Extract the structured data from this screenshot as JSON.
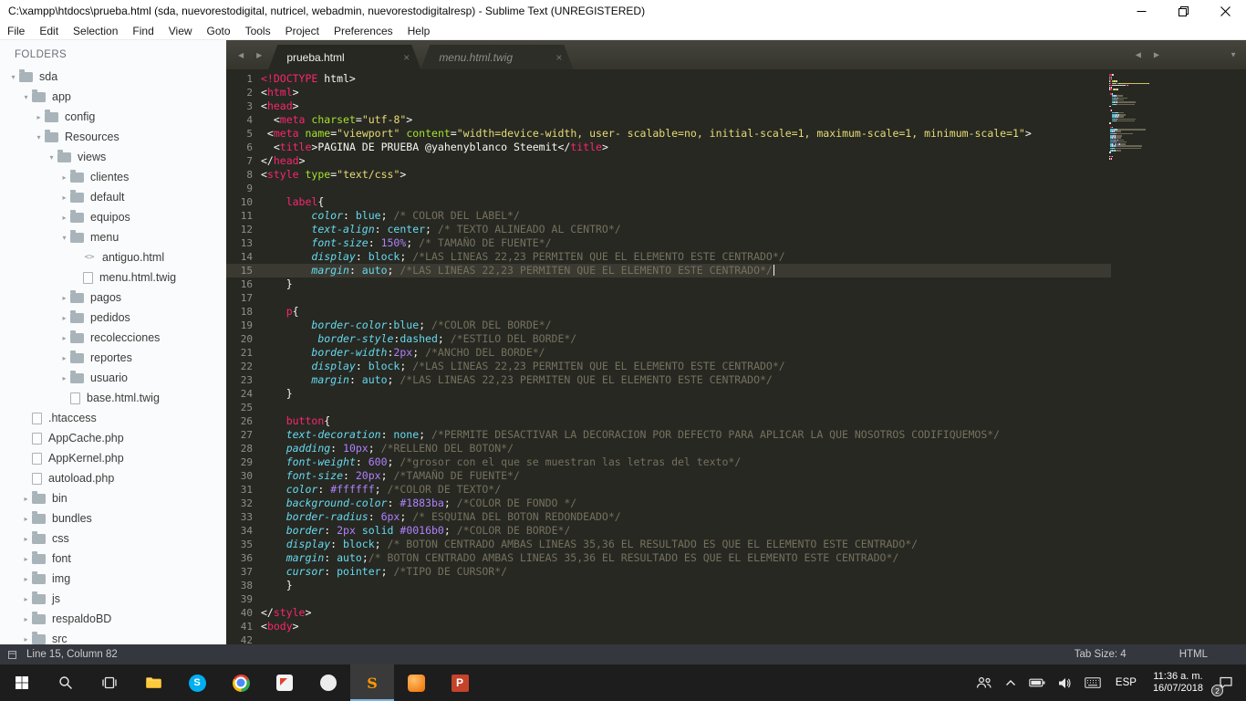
{
  "window": {
    "title": "C:\\xampp\\htdocs\\prueba.html (sda, nuevorestodigital, nutricel, webadmin, nuevorestodigitalresp) - Sublime Text (UNREGISTERED)"
  },
  "menubar": {
    "items": [
      "File",
      "Edit",
      "Selection",
      "Find",
      "View",
      "Goto",
      "Tools",
      "Project",
      "Preferences",
      "Help"
    ]
  },
  "sidebar": {
    "header": "FOLDERS",
    "items": [
      {
        "level": 0,
        "kind": "folder-open",
        "label": "sda"
      },
      {
        "level": 1,
        "kind": "folder-open",
        "label": "app"
      },
      {
        "level": 2,
        "kind": "folder-closed",
        "label": "config"
      },
      {
        "level": 2,
        "kind": "folder-open",
        "label": "Resources"
      },
      {
        "level": 3,
        "kind": "folder-open",
        "label": "views"
      },
      {
        "level": 4,
        "kind": "folder-closed",
        "label": "clientes"
      },
      {
        "level": 4,
        "kind": "folder-closed",
        "label": "default"
      },
      {
        "level": 4,
        "kind": "folder-closed",
        "label": "equipos"
      },
      {
        "level": 4,
        "kind": "folder-open",
        "label": "menu"
      },
      {
        "level": 5,
        "kind": "file-code",
        "label": "antiguo.html"
      },
      {
        "level": 5,
        "kind": "file",
        "label": "menu.html.twig"
      },
      {
        "level": 4,
        "kind": "folder-closed",
        "label": "pagos"
      },
      {
        "level": 4,
        "kind": "folder-closed",
        "label": "pedidos"
      },
      {
        "level": 4,
        "kind": "folder-closed",
        "label": "recolecciones"
      },
      {
        "level": 4,
        "kind": "folder-closed",
        "label": "reportes"
      },
      {
        "level": 4,
        "kind": "folder-closed",
        "label": "usuario"
      },
      {
        "level": 4,
        "kind": "file",
        "label": "base.html.twig"
      },
      {
        "level": 1,
        "kind": "file",
        "label": ".htaccess"
      },
      {
        "level": 1,
        "kind": "file",
        "label": "AppCache.php"
      },
      {
        "level": 1,
        "kind": "file",
        "label": "AppKernel.php"
      },
      {
        "level": 1,
        "kind": "file",
        "label": "autoload.php"
      },
      {
        "level": 1,
        "kind": "folder-closed",
        "label": "bin"
      },
      {
        "level": 1,
        "kind": "folder-closed",
        "label": "bundles"
      },
      {
        "level": 1,
        "kind": "folder-closed",
        "label": "css"
      },
      {
        "level": 1,
        "kind": "folder-closed",
        "label": "font"
      },
      {
        "level": 1,
        "kind": "folder-closed",
        "label": "img"
      },
      {
        "level": 1,
        "kind": "folder-closed",
        "label": "js"
      },
      {
        "level": 1,
        "kind": "folder-closed",
        "label": "respaldoBD"
      },
      {
        "level": 1,
        "kind": "folder-closed",
        "label": "src"
      }
    ]
  },
  "tabbar": {
    "tabs": [
      {
        "label": "prueba.html",
        "active": true
      },
      {
        "label": "menu.html.twig",
        "active": false
      }
    ]
  },
  "editor": {
    "current_line": 15,
    "lines": [
      [
        [
          "p",
          "<!DOCTYPE"
        ],
        [
          "w",
          " html>"
        ]
      ],
      [
        [
          "w",
          "<"
        ],
        [
          "p",
          "html"
        ],
        [
          "w",
          ">"
        ]
      ],
      [
        [
          "w",
          "<"
        ],
        [
          "p",
          "head"
        ],
        [
          "w",
          ">"
        ]
      ],
      [
        [
          "w",
          "  <"
        ],
        [
          "p",
          "meta"
        ],
        [
          "w",
          " "
        ],
        [
          "g",
          "charset"
        ],
        [
          "w",
          "="
        ],
        [
          "y",
          "\"utf-8\""
        ],
        [
          "w",
          ">"
        ]
      ],
      [
        [
          "w",
          " <"
        ],
        [
          "p",
          "meta"
        ],
        [
          "w",
          " "
        ],
        [
          "g",
          "name"
        ],
        [
          "w",
          "="
        ],
        [
          "y",
          "\"viewport\""
        ],
        [
          "w",
          " "
        ],
        [
          "g",
          "content"
        ],
        [
          "w",
          "="
        ],
        [
          "y",
          "\"width=device-width, user- scalable=no, initial-scale=1, maximum-scale=1, minimum-scale=1\""
        ],
        [
          "w",
          ">"
        ]
      ],
      [
        [
          "w",
          "  <"
        ],
        [
          "p",
          "title"
        ],
        [
          "w",
          ">"
        ],
        [
          "t",
          "PAGINA DE PRUEBA @yahenyblanco Steemit"
        ],
        [
          "w",
          "</"
        ],
        [
          "p",
          "title"
        ],
        [
          "w",
          ">"
        ]
      ],
      [
        [
          "w",
          "</"
        ],
        [
          "p",
          "head"
        ],
        [
          "w",
          ">"
        ]
      ],
      [
        [
          "w",
          "<"
        ],
        [
          "p",
          "style"
        ],
        [
          "w",
          " "
        ],
        [
          "g",
          "type"
        ],
        [
          "w",
          "="
        ],
        [
          "y",
          "\"text/css\""
        ],
        [
          "w",
          ">"
        ]
      ],
      [],
      [
        [
          "w",
          "    "
        ],
        [
          "p",
          "label"
        ],
        [
          "w",
          "{"
        ]
      ],
      [
        [
          "w",
          "        "
        ],
        [
          "ci",
          "color"
        ],
        [
          "w",
          ": "
        ],
        [
          "c",
          "blue"
        ],
        [
          "w",
          "; "
        ],
        [
          "cm",
          "/* COLOR DEL LABEL*/"
        ]
      ],
      [
        [
          "w",
          "        "
        ],
        [
          "ci",
          "text-align"
        ],
        [
          "w",
          ": "
        ],
        [
          "c",
          "center"
        ],
        [
          "w",
          "; "
        ],
        [
          "cm",
          "/* TEXTO ALINEADO AL CENTRO*/"
        ]
      ],
      [
        [
          "w",
          "        "
        ],
        [
          "ci",
          "font-size"
        ],
        [
          "w",
          ": "
        ],
        [
          "pu",
          "150%"
        ],
        [
          "w",
          "; "
        ],
        [
          "cm",
          "/* TAMAÑO DE FUENTE*/"
        ]
      ],
      [
        [
          "w",
          "        "
        ],
        [
          "ci",
          "display"
        ],
        [
          "w",
          ": "
        ],
        [
          "c",
          "block"
        ],
        [
          "w",
          "; "
        ],
        [
          "cm",
          "/*LAS LINEAS 22,23 PERMITEN QUE EL ELEMENTO ESTE CENTRADO*/"
        ]
      ],
      [
        [
          "w",
          "        "
        ],
        [
          "ci",
          "margin"
        ],
        [
          "w",
          ": "
        ],
        [
          "c",
          "auto"
        ],
        [
          "w",
          "; "
        ],
        [
          "cm",
          "/*LAS LINEAS 22,23 PERMITEN QUE EL ELEMENTO ESTE CENTRADO*/"
        ]
      ],
      [
        [
          "w",
          "    }"
        ]
      ],
      [],
      [
        [
          "w",
          "    "
        ],
        [
          "p",
          "p"
        ],
        [
          "w",
          "{"
        ]
      ],
      [
        [
          "w",
          "        "
        ],
        [
          "ci",
          "border-color"
        ],
        [
          "w",
          ":"
        ],
        [
          "c",
          "blue"
        ],
        [
          "w",
          "; "
        ],
        [
          "cm",
          "/*COLOR DEL BORDE*/"
        ]
      ],
      [
        [
          "w",
          "         "
        ],
        [
          "ci",
          "border-style"
        ],
        [
          "w",
          ":"
        ],
        [
          "c",
          "dashed"
        ],
        [
          "w",
          "; "
        ],
        [
          "cm",
          "/*ESTILO DEL BORDE*/"
        ]
      ],
      [
        [
          "w",
          "        "
        ],
        [
          "ci",
          "border-width"
        ],
        [
          "w",
          ":"
        ],
        [
          "pu",
          "2px"
        ],
        [
          "w",
          "; "
        ],
        [
          "cm",
          "/*ANCHO DEL BORDE*/"
        ]
      ],
      [
        [
          "w",
          "        "
        ],
        [
          "ci",
          "display"
        ],
        [
          "w",
          ": "
        ],
        [
          "c",
          "block"
        ],
        [
          "w",
          "; "
        ],
        [
          "cm",
          "/*LAS LINEAS 22,23 PERMITEN QUE EL ELEMENTO ESTE CENTRADO*/"
        ]
      ],
      [
        [
          "w",
          "        "
        ],
        [
          "ci",
          "margin"
        ],
        [
          "w",
          ": "
        ],
        [
          "c",
          "auto"
        ],
        [
          "w",
          "; "
        ],
        [
          "cm",
          "/*LAS LINEAS 22,23 PERMITEN QUE EL ELEMENTO ESTE CENTRADO*/"
        ]
      ],
      [
        [
          "w",
          "    }"
        ]
      ],
      [],
      [
        [
          "w",
          "    "
        ],
        [
          "p",
          "button"
        ],
        [
          "w",
          "{"
        ]
      ],
      [
        [
          "w",
          "    "
        ],
        [
          "ci",
          "text-decoration"
        ],
        [
          "w",
          ": "
        ],
        [
          "c",
          "none"
        ],
        [
          "w",
          "; "
        ],
        [
          "cm",
          "/*PERMITE DESACTIVAR LA DECORACION POR DEFECTO PARA APLICAR LA QUE NOSOTROS CODIFIQUEMOS*/"
        ]
      ],
      [
        [
          "w",
          "    "
        ],
        [
          "ci",
          "padding"
        ],
        [
          "w",
          ": "
        ],
        [
          "pu",
          "10px"
        ],
        [
          "w",
          "; "
        ],
        [
          "cm",
          "/*RELLENO DEL BOTON*/"
        ]
      ],
      [
        [
          "w",
          "    "
        ],
        [
          "ci",
          "font-weight"
        ],
        [
          "w",
          ": "
        ],
        [
          "pu",
          "600"
        ],
        [
          "w",
          "; "
        ],
        [
          "cm",
          "/*grosor con el que se muestran las letras del texto*/"
        ]
      ],
      [
        [
          "w",
          "    "
        ],
        [
          "ci",
          "font-size"
        ],
        [
          "w",
          ": "
        ],
        [
          "pu",
          "20px"
        ],
        [
          "w",
          "; "
        ],
        [
          "cm",
          "/*TAMAÑO DE FUENTE*/"
        ]
      ],
      [
        [
          "w",
          "    "
        ],
        [
          "ci",
          "color"
        ],
        [
          "w",
          ": "
        ],
        [
          "pu",
          "#ffffff"
        ],
        [
          "w",
          "; "
        ],
        [
          "cm",
          "/*COLOR DE TEXTO*/"
        ]
      ],
      [
        [
          "w",
          "    "
        ],
        [
          "ci",
          "background-color"
        ],
        [
          "w",
          ": "
        ],
        [
          "pu",
          "#1883ba"
        ],
        [
          "w",
          "; "
        ],
        [
          "cm",
          "/*COLOR DE FONDO */"
        ]
      ],
      [
        [
          "w",
          "    "
        ],
        [
          "ci",
          "border-radius"
        ],
        [
          "w",
          ": "
        ],
        [
          "pu",
          "6px"
        ],
        [
          "w",
          "; "
        ],
        [
          "cm",
          "/* ESQUINA DEL BOTON REDONDEADO*/"
        ]
      ],
      [
        [
          "w",
          "    "
        ],
        [
          "ci",
          "border"
        ],
        [
          "w",
          ": "
        ],
        [
          "pu",
          "2px"
        ],
        [
          "w",
          " "
        ],
        [
          "c",
          "solid"
        ],
        [
          "w",
          " "
        ],
        [
          "pu",
          "#0016b0"
        ],
        [
          "w",
          "; "
        ],
        [
          "cm",
          "/*COLOR DE BORDE*/"
        ]
      ],
      [
        [
          "w",
          "    "
        ],
        [
          "ci",
          "display"
        ],
        [
          "w",
          ": "
        ],
        [
          "c",
          "block"
        ],
        [
          "w",
          "; "
        ],
        [
          "cm",
          "/* BOTON CENTRADO AMBAS LINEAS 35,36 EL RESULTADO ES QUE EL ELEMENTO ESTE CENTRADO*/"
        ]
      ],
      [
        [
          "w",
          "    "
        ],
        [
          "ci",
          "margin"
        ],
        [
          "w",
          ": "
        ],
        [
          "c",
          "auto"
        ],
        [
          "w",
          ";"
        ],
        [
          "cm",
          "/* BOTON CENTRADO AMBAS LINEAS 35,36 EL RESULTADO ES QUE EL ELEMENTO ESTE CENTRADO*/"
        ]
      ],
      [
        [
          "w",
          "    "
        ],
        [
          "ci",
          "cursor"
        ],
        [
          "w",
          ": "
        ],
        [
          "c",
          "pointer"
        ],
        [
          "w",
          "; "
        ],
        [
          "cm",
          "/*TIPO DE CURSOR*/"
        ]
      ],
      [
        [
          "w",
          "    }"
        ]
      ],
      [],
      [
        [
          "w",
          "</"
        ],
        [
          "p",
          "style"
        ],
        [
          "w",
          ">"
        ]
      ],
      [
        [
          "w",
          "<"
        ],
        [
          "p",
          "body"
        ],
        [
          "w",
          ">"
        ]
      ],
      []
    ]
  },
  "statusbar": {
    "position": "Line 15, Column 82",
    "tab_size": "Tab Size: 4",
    "syntax": "HTML"
  },
  "taskbar": {
    "apps": [
      {
        "name": "start",
        "icon": "windows-logo-icon"
      },
      {
        "name": "search",
        "icon": "search-icon"
      },
      {
        "name": "task-view",
        "icon": "task-view-icon"
      },
      {
        "name": "file-explorer",
        "icon": "explorer-folder-icon"
      },
      {
        "name": "skype",
        "icon": "skype-icon"
      },
      {
        "name": "chrome",
        "icon": "chrome-icon"
      },
      {
        "name": "flag-app",
        "icon": "flag-app-icon"
      },
      {
        "name": "circle-app",
        "icon": "circle-app-icon"
      },
      {
        "name": "sublime-text",
        "icon": "sublime-icon",
        "active": true
      },
      {
        "name": "orange-app",
        "icon": "orange-app-icon"
      },
      {
        "name": "powerpoint",
        "icon": "powerpoint-icon"
      }
    ],
    "app_letters": {
      "skype": "S",
      "powerpoint": "P",
      "sublime": "S"
    },
    "tray": {
      "language": "ESP",
      "time": "11:36 a. m.",
      "date": "16/07/2018",
      "notification_count": "2"
    }
  },
  "palette": {
    "editor_bg": "#272822",
    "pink": "#f92672",
    "green": "#a6e22e",
    "yellow": "#e6db74",
    "cyan": "#66d9ef",
    "purple": "#ae81ff",
    "comment": "#75715e",
    "accent_orange": "#ff9800"
  }
}
